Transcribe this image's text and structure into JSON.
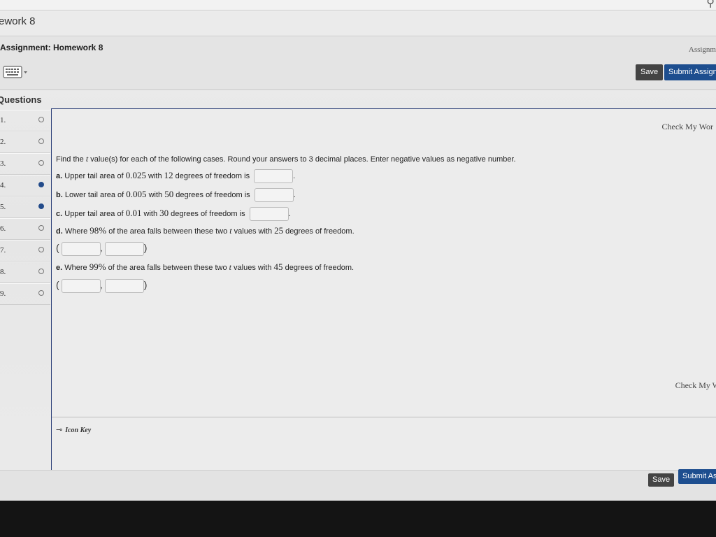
{
  "header": {
    "title": "ework 8",
    "assignment": "Assignment: Homework 8",
    "assignment_right": "Assignm",
    "save_label": "Save",
    "submit_label": "Submit Assign",
    "search_icon": "search-icon",
    "keyboard_icon": "keyboard-icon"
  },
  "sidebar": {
    "heading": "Questions",
    "items": [
      {
        "num": "1.",
        "status": "unanswered"
      },
      {
        "num": "2.",
        "status": "unanswered"
      },
      {
        "num": "3.",
        "status": "unanswered"
      },
      {
        "num": "4.",
        "status": "answered"
      },
      {
        "num": "5.",
        "status": "answered"
      },
      {
        "num": "6.",
        "status": "unanswered"
      },
      {
        "num": "7.",
        "status": "unanswered"
      },
      {
        "num": "8.",
        "status": "unanswered"
      },
      {
        "num": "9.",
        "status": "unanswered"
      }
    ]
  },
  "question": {
    "check_top": "Check My Wor",
    "check_bottom": "Check My W",
    "intro_pre": "Find the ",
    "intro_var": "t",
    "intro_post": " value(s) for each of the following cases. Round your answers to 3 decimal places. Enter negative values as negative number.",
    "a": {
      "label": "a.",
      "p1": " Upper tail area of ",
      "v1": "0.025",
      "p2": " with ",
      "v2": "12",
      "p3": " degrees of freedom is"
    },
    "b": {
      "label": "b.",
      "p1": " Lower tail area of ",
      "v1": "0.005",
      "p2": " with ",
      "v2": "50",
      "p3": " degrees of freedom is"
    },
    "c": {
      "label": "c.",
      "p1": " Upper tail area of ",
      "v1": "0.01",
      "p2": " with ",
      "v2": "30",
      "p3": " degrees of freedom is"
    },
    "d": {
      "label": "d.",
      "p1": " Where ",
      "v1": "98%",
      "p2": " of the area falls between these two ",
      "var": "t",
      "p3": " values with ",
      "v2": "25",
      "p4": " degrees of freedom."
    },
    "e": {
      "label": "e.",
      "p1": " Where ",
      "v1": "99%",
      "p2": " of the area falls between these two ",
      "var": "t",
      "p3": " values with ",
      "v2": "45",
      "p4": " degrees of freedom."
    },
    "icon_key": "Icon Key",
    "punct": {
      "period": ".",
      "comma": ",",
      "open": "(",
      "close": ")"
    }
  },
  "footer": {
    "save_label": "Save",
    "submit_label": "Submit As"
  }
}
